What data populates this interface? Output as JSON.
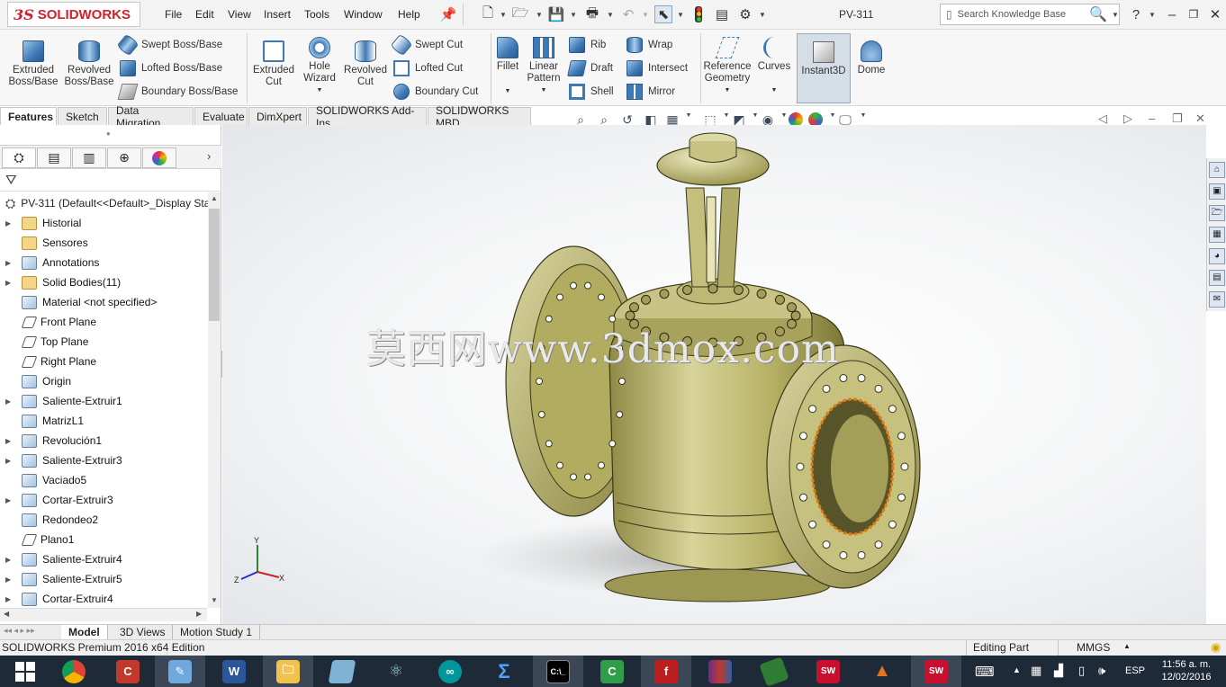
{
  "app": {
    "logo_ds": "3S",
    "logo_text": "SOLIDWORKS",
    "document_title": "PV-311"
  },
  "menu": [
    "File",
    "Edit",
    "View",
    "Insert",
    "Tools",
    "Window",
    "Help"
  ],
  "search": {
    "placeholder": "Search Knowledge Base"
  },
  "ribbon": {
    "extruded_boss": "Extruded Boss/Base",
    "revolved_boss": "Revolved Boss/Base",
    "swept_boss": "Swept Boss/Base",
    "lofted_boss": "Lofted Boss/Base",
    "boundary_boss": "Boundary Boss/Base",
    "extruded_cut": "Extruded Cut",
    "hole_wizard": "Hole Wizard",
    "revolved_cut": "Revolved Cut",
    "swept_cut": "Swept Cut",
    "lofted_cut": "Lofted Cut",
    "boundary_cut": "Boundary Cut",
    "fillet": "Fillet",
    "linear_pattern": "Linear Pattern",
    "rib": "Rib",
    "draft": "Draft",
    "shell": "Shell",
    "wrap": "Wrap",
    "intersect": "Intersect",
    "mirror": "Mirror",
    "reference_geometry": "Reference Geometry",
    "curves": "Curves",
    "instant3d": "Instant3D",
    "dome": "Dome"
  },
  "tabs": [
    "Features",
    "Sketch",
    "Data Migration",
    "Evaluate",
    "DimXpert",
    "SOLIDWORKS Add-Ins",
    "SOLIDWORKS MBD"
  ],
  "tree": {
    "root": "PV-311  (Default<<Default>_Display Sta",
    "items": [
      {
        "label": "Historial",
        "expand": true,
        "icon": "history"
      },
      {
        "label": "Sensores",
        "expand": false,
        "icon": "folder"
      },
      {
        "label": "Annotations",
        "expand": true,
        "icon": "annotation"
      },
      {
        "label": "Solid Bodies(11)",
        "expand": true,
        "icon": "folder"
      },
      {
        "label": "Material <not specified>",
        "expand": false,
        "icon": "material"
      },
      {
        "label": "Front Plane",
        "expand": false,
        "icon": "plane"
      },
      {
        "label": "Top Plane",
        "expand": false,
        "icon": "plane"
      },
      {
        "label": "Right Plane",
        "expand": false,
        "icon": "plane"
      },
      {
        "label": "Origin",
        "expand": false,
        "icon": "origin"
      },
      {
        "label": "Saliente-Extruir1",
        "expand": true,
        "icon": "feature"
      },
      {
        "label": "MatrizL1",
        "expand": false,
        "icon": "pattern"
      },
      {
        "label": "Revolución1",
        "expand": true,
        "icon": "feature"
      },
      {
        "label": "Saliente-Extruir3",
        "expand": true,
        "icon": "feature"
      },
      {
        "label": "Vaciado5",
        "expand": false,
        "icon": "feature"
      },
      {
        "label": "Cortar-Extruir3",
        "expand": true,
        "icon": "feature"
      },
      {
        "label": "Redondeo2",
        "expand": false,
        "icon": "feature"
      },
      {
        "label": "Plano1",
        "expand": false,
        "icon": "plane"
      },
      {
        "label": "Saliente-Extruir4",
        "expand": true,
        "icon": "feature"
      },
      {
        "label": "Saliente-Extruir5",
        "expand": true,
        "icon": "feature"
      },
      {
        "label": "Cortar-Extruir4",
        "expand": true,
        "icon": "feature"
      }
    ]
  },
  "viewport": {
    "watermark": "莫西网www.3dmox.com",
    "triad": {
      "x": "X",
      "y": "Y",
      "z": "Z"
    }
  },
  "bottom_tabs": [
    "Model",
    "3D Views",
    "Motion Study 1"
  ],
  "status": {
    "edition": "SOLIDWORKS Premium 2016 x64 Edition",
    "mode": "Editing Part",
    "units": "MMGS"
  },
  "taskbar": {
    "language": "ESP",
    "time": "11:56 a. m.",
    "date": "12/02/2016"
  },
  "colors": {
    "accent": "#d2202f",
    "model": "#b4ae62",
    "edge": "#e07a10",
    "taskbar": "#1f2a38"
  }
}
